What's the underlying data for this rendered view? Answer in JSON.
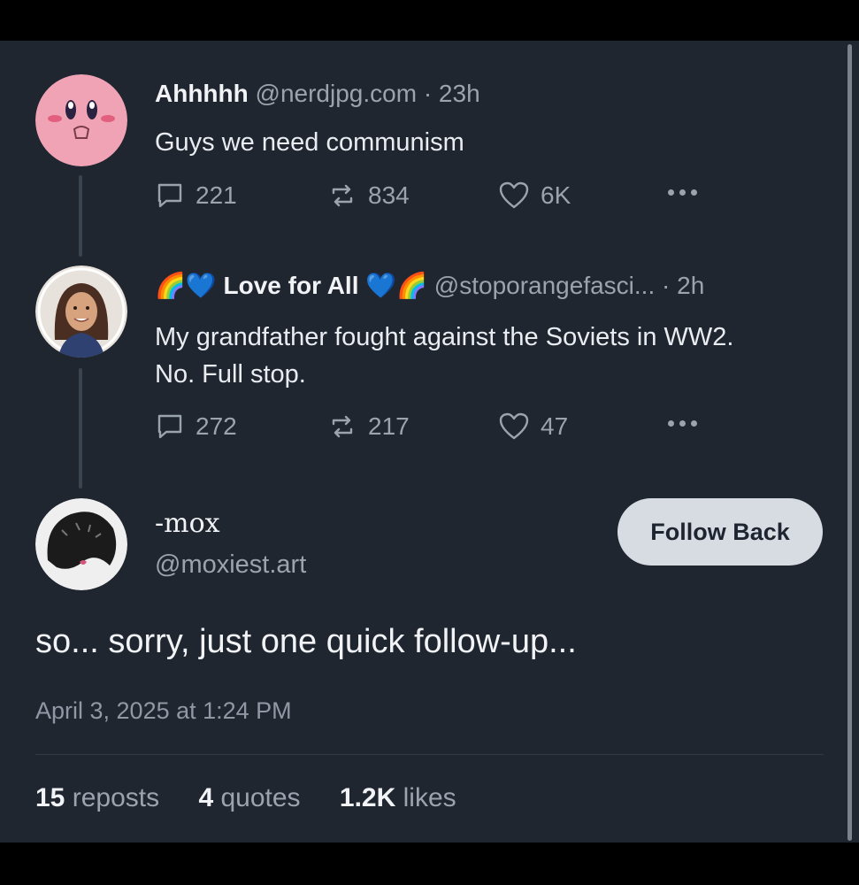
{
  "posts": [
    {
      "author": "Ahhhhh",
      "handle": "@nerdjpg.com · 23h",
      "text": "Guys we need communism",
      "replies": "221",
      "reposts": "834",
      "likes": "6K",
      "avatar_icon": "kirby-avatar"
    },
    {
      "author_prefix_emoji": "🌈💙",
      "author": "Love for All",
      "author_suffix_emoji": "💙🌈",
      "handle": "@stoporangefasci... · 2h",
      "text": "My grandfather fought against the Soviets in WW2. No. Full stop.",
      "replies": "272",
      "reposts": "217",
      "likes": "47",
      "avatar_icon": "woman-portrait-avatar"
    }
  ],
  "reply": {
    "display_name": "-mox",
    "handle": "@moxiest.art",
    "follow_button": "Follow Back",
    "text": "so... sorry, just one quick follow-up...",
    "timestamp": "April 3, 2025 at 1:24 PM",
    "stats": {
      "reposts_count": "15",
      "reposts_label": "reposts",
      "quotes_count": "4",
      "quotes_label": "quotes",
      "likes_count": "1.2K",
      "likes_label": "likes"
    }
  },
  "colors": {
    "background": "#202630",
    "muted_text": "#9aa3ae",
    "button_bg": "#d7dce3"
  }
}
